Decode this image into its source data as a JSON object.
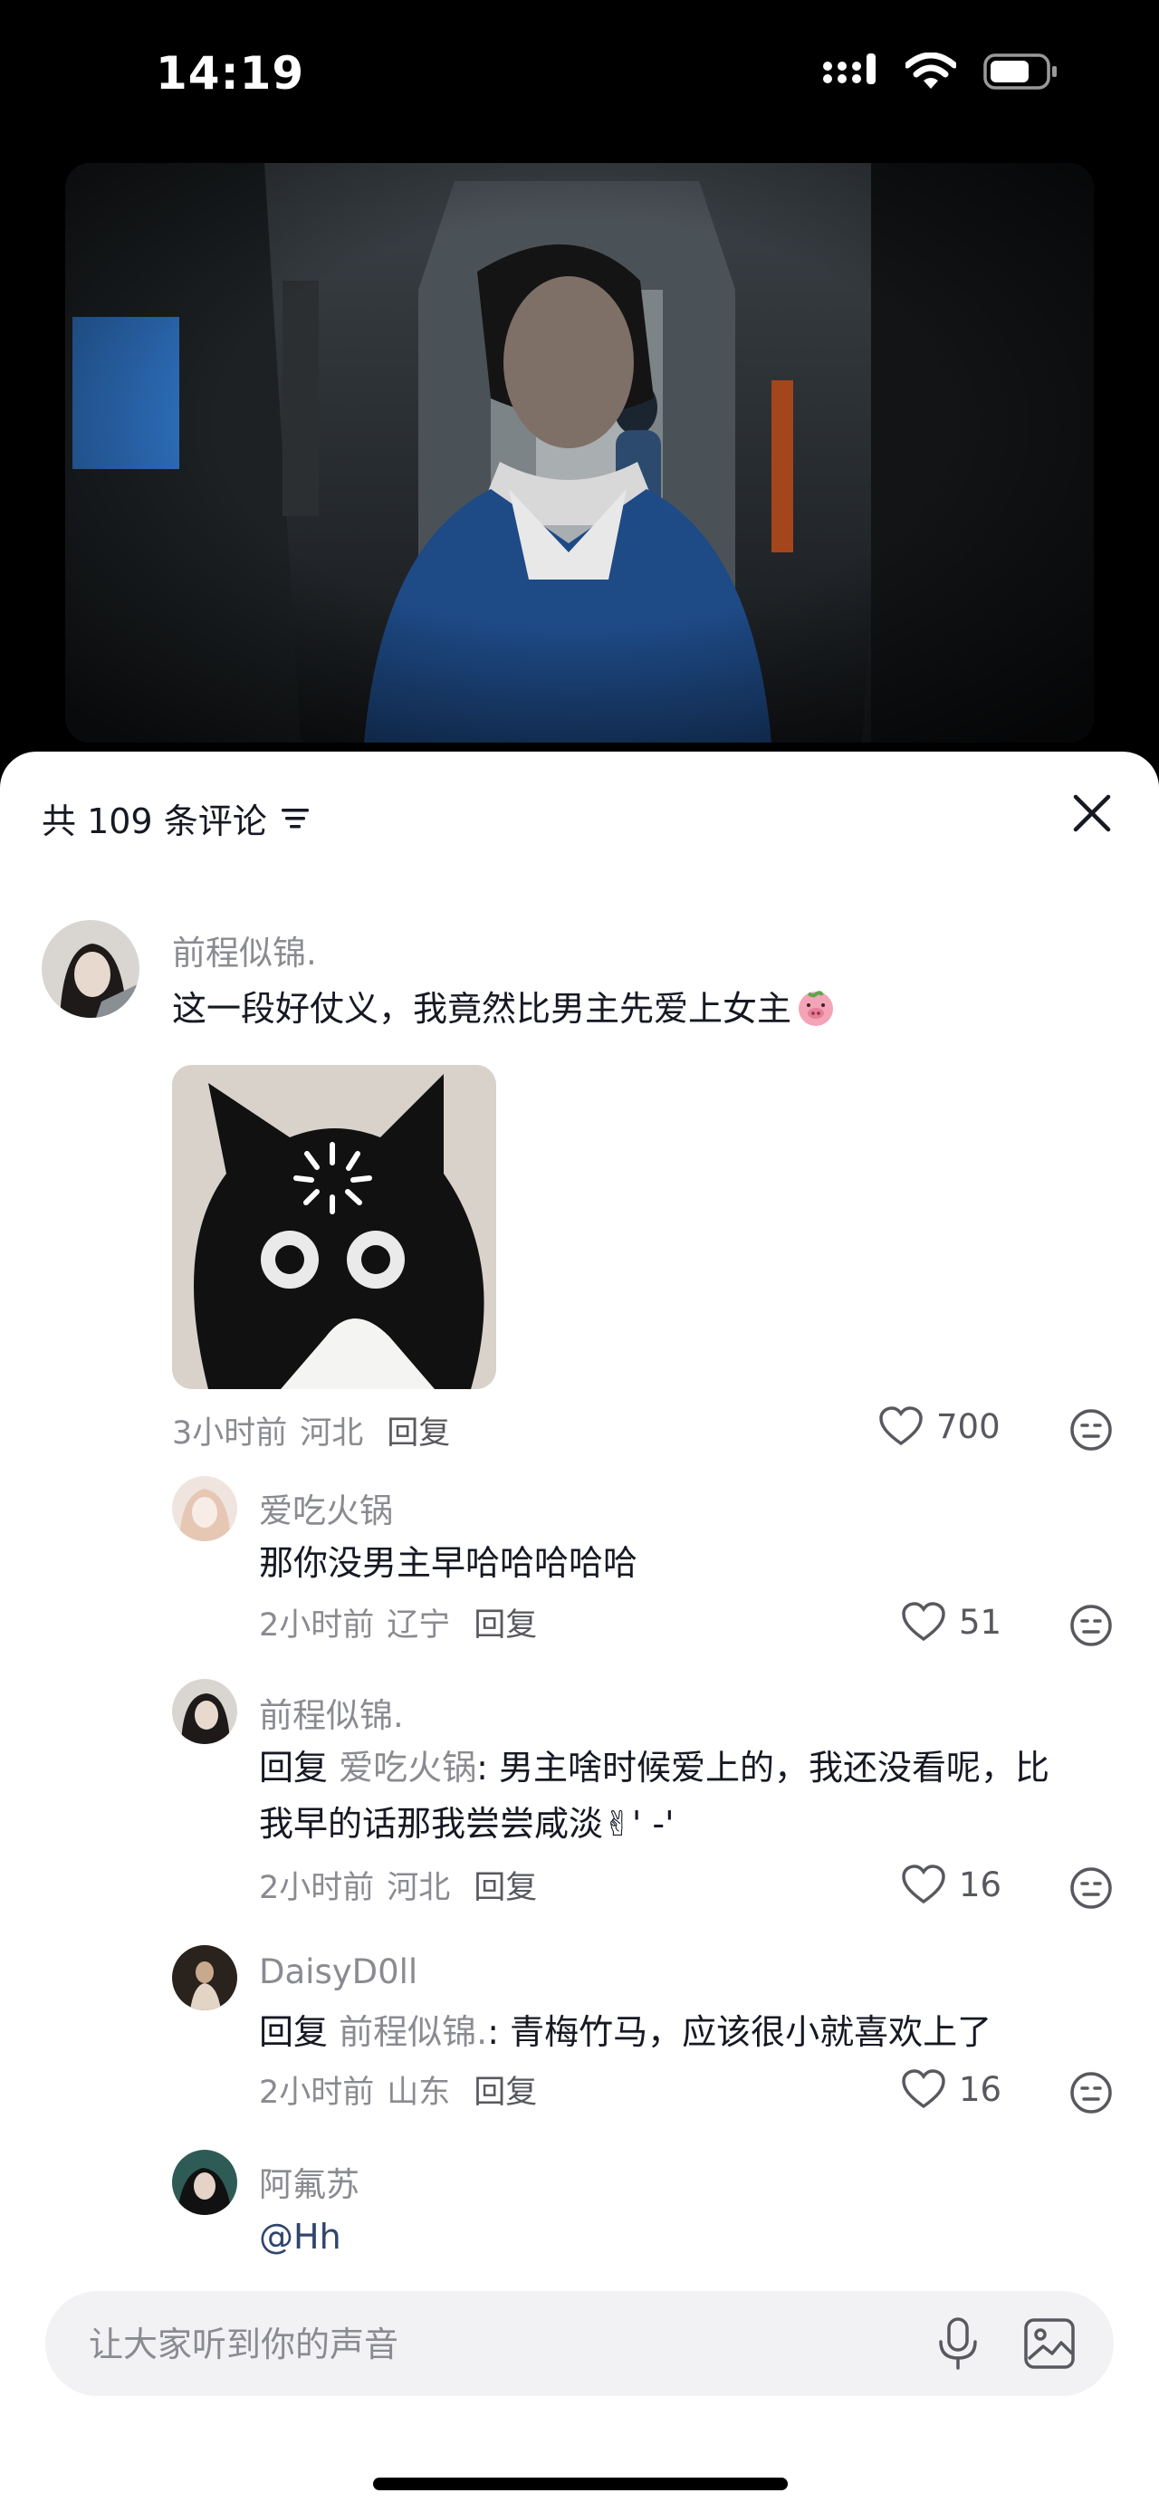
{
  "status_bar": {
    "time": "14:19"
  },
  "comments_header": {
    "title": "共 109 条评论"
  },
  "comments": [
    {
      "author": "前程似锦.",
      "text": "这一段好仗义，我竟然比男主先爱上女主",
      "time": "3小时前",
      "location": "河北",
      "reply_label": "回复",
      "likes": "700"
    }
  ],
  "replies": [
    {
      "author": "爱吃火锅",
      "text": "那你没男主早哈哈哈哈哈",
      "time": "2小时前",
      "location": "辽宁",
      "reply_label": "回复",
      "likes": "51"
    },
    {
      "author": "前程似锦.",
      "reply_prefix": "回复",
      "reply_to": "爱吃火锅",
      "text_line1": ": 男主啥时候爱上的，我还没看呢，比",
      "text_line2": "我早的话那我尝尝咸淡✌' -'",
      "time": "2小时前",
      "location": "河北",
      "reply_label": "回复",
      "likes": "16"
    },
    {
      "author": "DaisyD0ll",
      "reply_prefix": "回复",
      "reply_to": "前程似锦.",
      "text": ": 青梅竹马，应该很小就喜欢上了",
      "time": "2小时前",
      "location": "山东",
      "reply_label": "回复",
      "likes": "16"
    },
    {
      "author": "阿氟苏",
      "text": "@Hh"
    }
  ],
  "input": {
    "placeholder": "让大家听到你的声音"
  },
  "icons": {
    "heart": "heart-icon",
    "emoji": "emoji-icon",
    "close": "close-icon",
    "mic": "microphone-icon",
    "image": "image-icon",
    "sort": "sort-icon"
  },
  "colors": {
    "accent_link": "#30456e",
    "muted": "#8a8b91"
  }
}
